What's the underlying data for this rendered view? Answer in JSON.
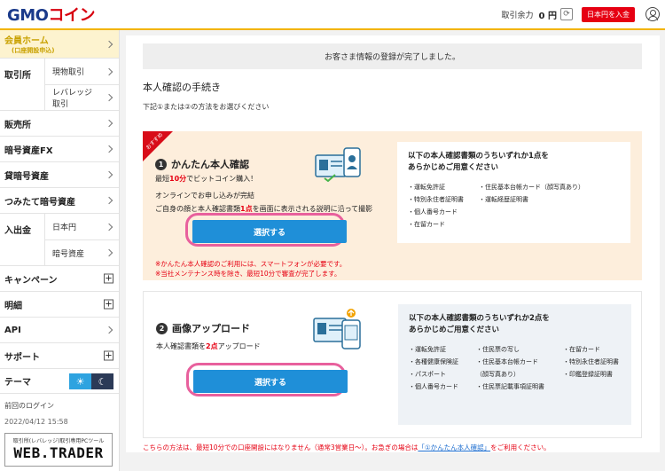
{
  "header": {
    "logo_main": "GMO",
    "logo_sub": "コイン",
    "balance_label": "取引余力",
    "balance_value": "0 円",
    "deposit_button": "日本円を入金"
  },
  "sidebar": {
    "home_label": "会員ホーム",
    "home_sub": "(口座開設申込)",
    "trading_label": "取引所",
    "trading_items": [
      "現物取引",
      "レバレッジ取引"
    ],
    "items": [
      "販売所",
      "暗号資産FX",
      "貸暗号資産",
      "つみたて暗号資産"
    ],
    "deposit_label": "入出金",
    "deposit_items": [
      "日本円",
      "暗号資産"
    ],
    "plus_items": [
      "キャンペーン",
      "明細",
      "サポート"
    ],
    "api_label": "API",
    "theme_label": "テーマ",
    "last_login_label": "前回のログイン",
    "last_login_value": "2022/04/12 15:58",
    "webtrader_sub": "取引所(レバレッジ)取引専用PCツール",
    "webtrader_name": "WEB.TRADER"
  },
  "main": {
    "notice": "お客さま情報の登録が完了しました。",
    "title": "本人確認の手続き",
    "subtitle": "下記①または②の方法をお選びください",
    "option1": {
      "ribbon": "おすすめ",
      "number": "1",
      "title": "かんたん本人確認",
      "lead_pre": "最短",
      "lead_red": "10分",
      "lead_post": "でビットコイン購入！",
      "line1": "オンラインでお申し込みが完結",
      "line2_pre": "ご自身の顔と本人確認書類",
      "line2_red": "1点",
      "line2_post": "を画面に表示される説明に沿って撮影",
      "button": "選択する",
      "note1": "※かんたん本人確認のご利用には、スマートフォンが必要です。",
      "note2": "※当社メンテナンス時を除き、最短10分で審査が完了します。",
      "req_line1": "以下の本人確認書類のうちいずれか1点を",
      "req_line2": "あらかじめご用意ください",
      "docs": [
        "・運転免許証",
        "・住民基本台帳カード（顔写真あり）",
        "・特別永住者証明書",
        "・運転経歴証明書",
        "・個人番号カード",
        "",
        "・在留カード",
        ""
      ]
    },
    "option2": {
      "number": "2",
      "title": "画像アップロード",
      "desc_pre": "本人確認書類を",
      "desc_red": "2点",
      "desc_post": "アップロード",
      "button": "選択する",
      "req_line1": "以下の本人確認書類のうちいずれか2点を",
      "req_line2": "あらかじめご用意ください",
      "docs": [
        "・運転免許証",
        "・住民票の写し",
        "・在留カード",
        "・各種健康保険証",
        "・住民基本台帳カード",
        "・特別永住者証明書",
        "・パスポート",
        "（顔写真あり）",
        "・印鑑登録証明書",
        "・個人番号カード",
        "・住民票記載事項証明書",
        ""
      ]
    },
    "footer_pre": "こちらの方法は、最短10分での口座開設にはなりません（通常3営業日〜）。お急ぎの場合は",
    "footer_link": "「①かんたん本人確認」",
    "footer_post": "をご利用ください。"
  }
}
